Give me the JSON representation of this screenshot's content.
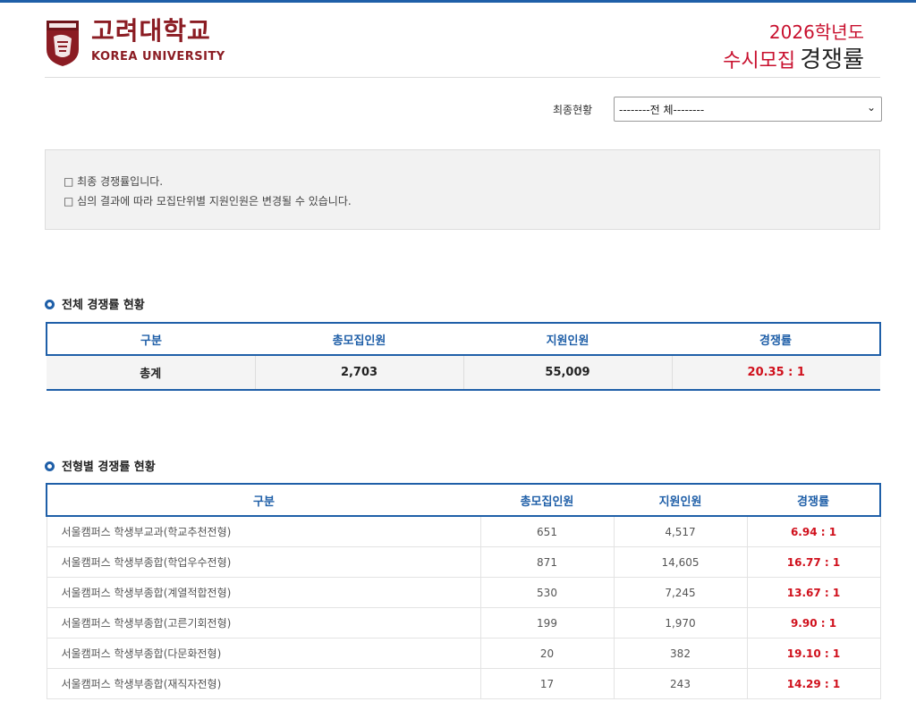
{
  "header": {
    "university_kr": "고려대학교",
    "university_en": "KOREA UNIVERSITY",
    "year_label": "2026학년도",
    "title_red": "수시모집",
    "title_black": "경쟁률"
  },
  "status": {
    "label": "최종현황",
    "selected": "--------전 체--------"
  },
  "notice": [
    "□ 최종 경쟁률입니다.",
    "□ 심의 결과에 따라 모집단위별 지원인원은 변경될 수 있습니다."
  ],
  "overall": {
    "title": "전체 경쟁률 현황",
    "columns": [
      "구분",
      "총모집인원",
      "지원인원",
      "경쟁률"
    ],
    "row": {
      "category": "총계",
      "quota": "2,703",
      "applicants": "55,009",
      "rate": "20.35 : 1"
    }
  },
  "by_type": {
    "title": "전형별 경쟁률 현황",
    "columns": [
      "구분",
      "총모집인원",
      "지원인원",
      "경쟁률"
    ],
    "rows": [
      {
        "category": "서울캠퍼스 학생부교과(학교추천전형)",
        "quota": "651",
        "applicants": "4,517",
        "rate": "6.94 : 1"
      },
      {
        "category": "서울캠퍼스 학생부종합(학업우수전형)",
        "quota": "871",
        "applicants": "14,605",
        "rate": "16.77 : 1"
      },
      {
        "category": "서울캠퍼스 학생부종합(계열적합전형)",
        "quota": "530",
        "applicants": "7,245",
        "rate": "13.67 : 1"
      },
      {
        "category": "서울캠퍼스 학생부종합(고른기회전형)",
        "quota": "199",
        "applicants": "1,970",
        "rate": "9.90 : 1"
      },
      {
        "category": "서울캠퍼스 학생부종합(다문화전형)",
        "quota": "20",
        "applicants": "382",
        "rate": "19.10 : 1"
      },
      {
        "category": "서울캠퍼스 학생부종합(재직자전형)",
        "quota": "17",
        "applicants": "243",
        "rate": "14.29 : 1"
      }
    ]
  },
  "colors": {
    "primary_blue": "#1f5fa8",
    "brand_crimson": "#8b1c23",
    "rate_red": "#d0101c"
  }
}
